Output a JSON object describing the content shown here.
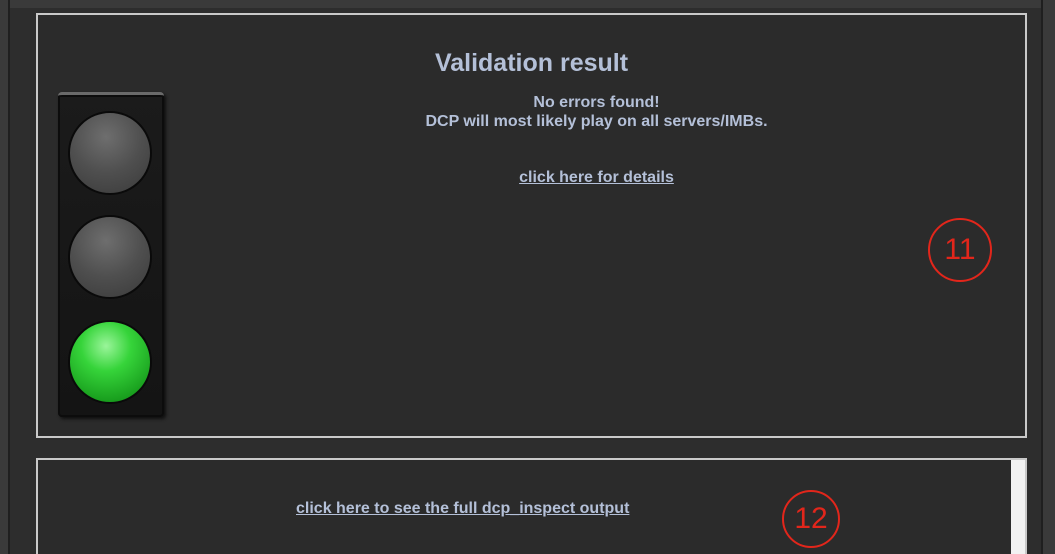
{
  "validation_panel": {
    "title": "Validation result",
    "message_line1": "No errors found!",
    "message_line2": "DCP will most likely play on all servers/IMBs.",
    "details_link": "click here for details",
    "status_light": {
      "lamps": [
        "off",
        "off",
        "on"
      ],
      "active_color": "#2ecc33"
    },
    "marker": "11"
  },
  "output_panel": {
    "full_output_link": "click here to see the full dcp_inspect output",
    "marker": "12"
  },
  "colors": {
    "text": "#b4c0d8",
    "annotation": "#e2261b",
    "panel_border": "#c9c9c9",
    "background": "#2b2b2b"
  }
}
